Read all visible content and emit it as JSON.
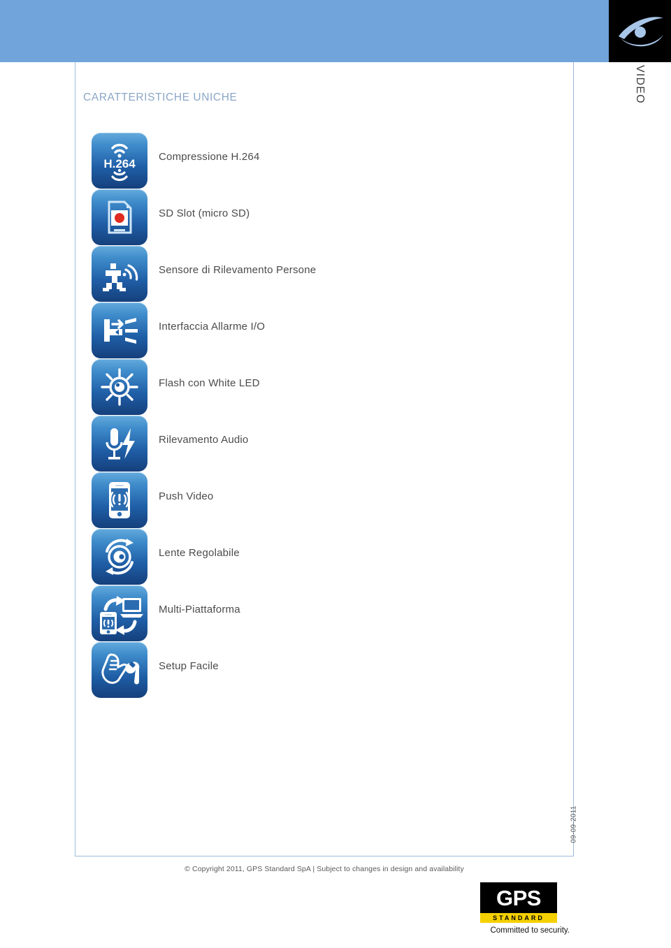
{
  "header": {
    "band_color": "#70a4da",
    "logo_square_color": "#000000",
    "eye_logo_name": "eye-logo",
    "vertical_tab_label": "VIDEO"
  },
  "section": {
    "title": "CARATTERISTICHE UNICHE",
    "title_color": "#8aa6c6"
  },
  "features": [
    {
      "icon": "h264-compression-icon",
      "label": "Compressione H.264"
    },
    {
      "icon": "sd-card-icon",
      "label": "SD Slot (micro SD)"
    },
    {
      "icon": "person-detection-icon",
      "label": "Sensore di Rilevamento Persone"
    },
    {
      "icon": "alarm-io-icon",
      "label": "Interfaccia Allarme I/O"
    },
    {
      "icon": "white-led-flash-icon",
      "label": "Flash con White LED"
    },
    {
      "icon": "audio-detection-icon",
      "label": "Rilevamento Audio"
    },
    {
      "icon": "push-video-icon",
      "label": "Push Video"
    },
    {
      "icon": "adjustable-lens-icon",
      "label": "Lente Regolabile"
    },
    {
      "icon": "multi-platform-icon",
      "label": "Multi-Piattaforma"
    },
    {
      "icon": "easy-setup-icon",
      "label": "Setup Facile"
    }
  ],
  "footer": {
    "date": "09-09-2011",
    "copyright": "© Copyright 2011, GPS Standard SpA | Subject to changes in design and availability",
    "logo": {
      "name": "GPS",
      "subtitle": "STANDARD",
      "tagline": "Committed to security.",
      "black": "#000000",
      "yellow": "#f5d000"
    }
  }
}
